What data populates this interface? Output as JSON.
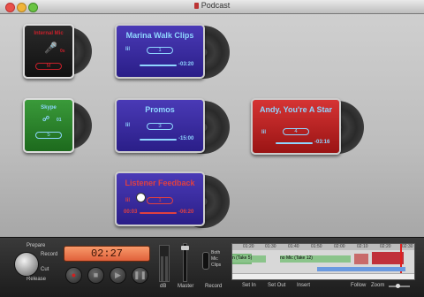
{
  "window": {
    "title": "Podcast"
  },
  "cards": {
    "internal_mic": {
      "title": "Internal Mic",
      "count": "M"
    },
    "skype": {
      "title": "Skype",
      "count": "5",
      "num": "01"
    },
    "marina": {
      "title": "Marina Walk Clips",
      "count": "1",
      "time": "-03:20"
    },
    "promos": {
      "title": "Promos",
      "count": "3",
      "time": "-15:00"
    },
    "andy": {
      "title": "Andy, You're A Star",
      "count": "4",
      "time": "-03:16"
    },
    "listener": {
      "title": "Listener Feedback",
      "count": "1",
      "elapsed": "00:03",
      "time": "-06:20"
    }
  },
  "controls": {
    "prepare": "Prepare",
    "record": "Record",
    "cut": "Cut",
    "release": "Release",
    "counter": "02:27",
    "db": "dB",
    "master": "Master",
    "record_label": "Record",
    "both_mic_clips": "Both\nMic\nClips"
  },
  "timeline": {
    "ruler": [
      "01:20",
      "01:30",
      "01:40",
      "01:50",
      "02:00",
      "02:10",
      "02:20",
      "02:30"
    ],
    "track1_label": "n (Take 5)",
    "track2_label": "no Mic (Take 12)",
    "set_in": "Set In",
    "set_out": "Set Out",
    "insert": "Insert",
    "follow": "Follow",
    "zoom": "Zoom"
  },
  "colors": {
    "red": "#c8202a",
    "blue": "#3a2b9a",
    "green": "#2a8a2a",
    "counter": "#f0764e"
  }
}
